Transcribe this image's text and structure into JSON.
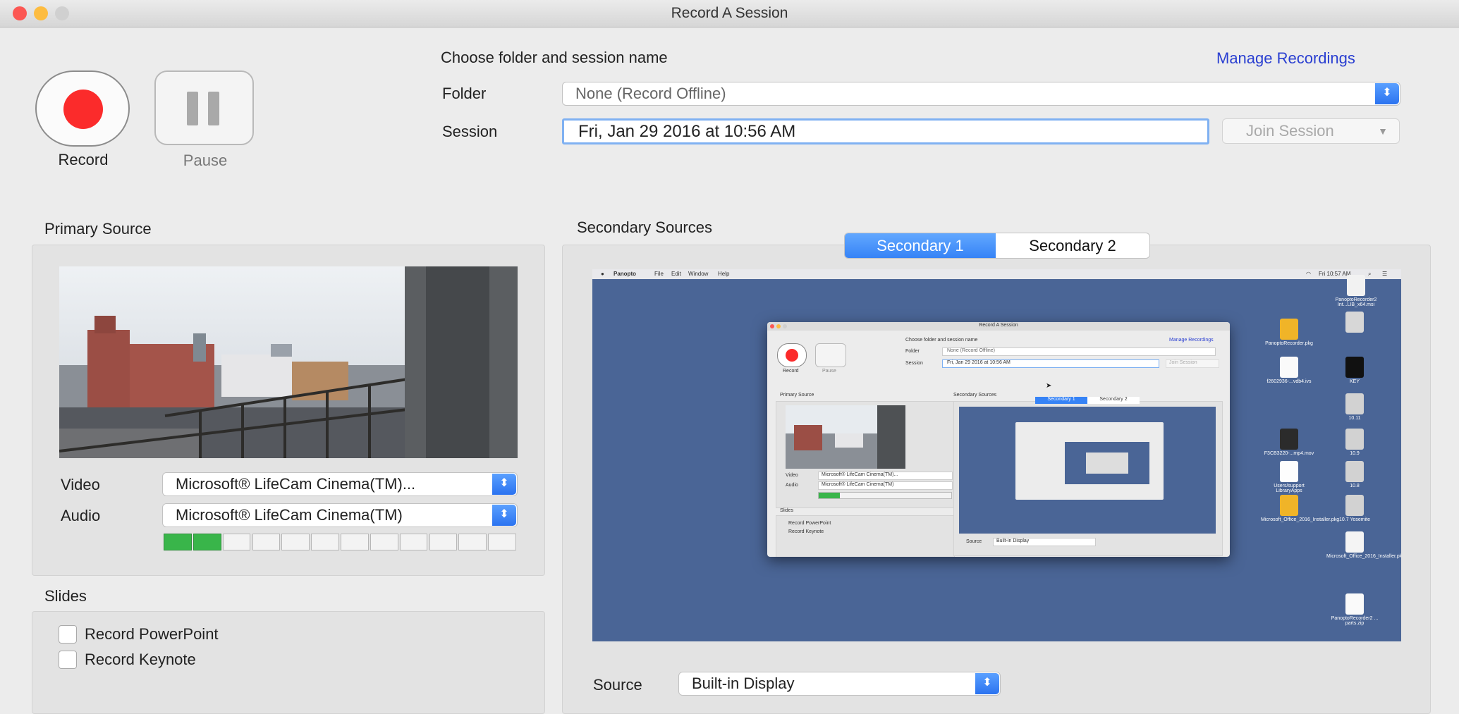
{
  "window": {
    "title": "Record A Session"
  },
  "controls": {
    "record_label": "Record",
    "pause_label": "Pause"
  },
  "header": {
    "choose_label": "Choose folder and session name",
    "manage_link": "Manage Recordings",
    "folder_label": "Folder",
    "folder_value": "None (Record Offline)",
    "session_label": "Session",
    "session_value": "Fri, Jan 29 2016 at 10:56 AM",
    "join_label": "Join Session"
  },
  "primary": {
    "title": "Primary Source",
    "video_label": "Video",
    "video_value": "Microsoft® LifeCam Cinema(TM)...",
    "audio_label": "Audio",
    "audio_value": "Microsoft® LifeCam Cinema(TM)",
    "audio_level": {
      "active_segments": 2,
      "total_segments": 12
    }
  },
  "slides": {
    "title": "Slides",
    "record_powerpoint": "Record PowerPoint",
    "record_keynote": "Record Keynote"
  },
  "secondary": {
    "title": "Secondary Sources",
    "tabs": [
      "Secondary 1",
      "Secondary 2"
    ],
    "selected_tab": "Secondary 1",
    "source_label": "Source",
    "source_value": "Built-in Display"
  },
  "desktop_capture": {
    "menu_items": [
      "Panopto",
      "File",
      "Edit",
      "Window",
      "Help"
    ],
    "clock": "Fri 10:57 AM",
    "desktop_items": [
      "PanoptoRecorder2 Int...LIB_x64.msi",
      "PanoptoRecorder.pkg",
      "f2602936-...vdb4.ivs",
      "KEY",
      "10.11",
      "F3CB3220-...mp4.mov",
      "10.9",
      "Users/support LibraryApps",
      "10.8",
      "Microsoft_Office_2016_Installer.pkg",
      "10.7 Yosemite",
      "Microsoft_Office_2016_Installer.pkg",
      "PanoptoRecorder2 ... parts.zip"
    ],
    "nested_window": {
      "title": "Record A Session",
      "choose_label": "Choose folder and session name",
      "manage_link": "Manage Recordings",
      "folder_label": "Folder",
      "folder_value": "None (Record Offline)",
      "session_label": "Session",
      "session_value": "Fri, Jan 29 2016 at 10:56 AM",
      "join_label": "Join Session",
      "record_label": "Record",
      "pause_label": "Pause",
      "primary_title": "Primary Source",
      "secondary_title": "Secondary Sources",
      "tabs": [
        "Secondary 1",
        "Secondary 2"
      ],
      "video_label": "Video",
      "video_value": "Microsoft® LifeCam Cinema(TM)...",
      "audio_label": "Audio",
      "audio_value": "Microsoft® LifeCam Cinema(TM)",
      "slides_title": "Slides",
      "record_powerpoint": "Record PowerPoint",
      "record_keynote": "Record Keynote",
      "source_label": "Source",
      "source_value": "Built-in Display"
    }
  },
  "colors": {
    "record_red": "#fb2b2b",
    "accent_blue": "#3683f6",
    "link_blue": "#2a3fd1",
    "meter_green": "#39b54a",
    "desktop_blue": "#4a6596"
  }
}
